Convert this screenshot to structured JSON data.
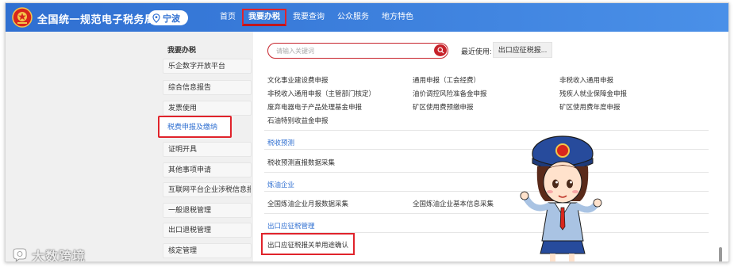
{
  "header": {
    "site_title": "全国统一规范电子税务局",
    "city": "宁波",
    "nav": [
      "首页",
      "我要办税",
      "我要查询",
      "公众服务",
      "地方特色"
    ]
  },
  "sidebar": {
    "heading": "我要办税",
    "items": [
      "乐企数字开放平台",
      "综合信息报告",
      "发票使用",
      "税费申报及缴纳",
      "证明开具",
      "其他事项申请",
      "互联网平台企业涉税信息报送",
      "一般退税管理",
      "出口退税管理",
      "核定管理"
    ]
  },
  "search": {
    "placeholder": "请输入关键词"
  },
  "recent": {
    "label": "最近使用:",
    "item": "出口应征税报..."
  },
  "sections": {
    "declare_links": [
      [
        "文化事业建设费申报",
        "通用申报（工会经费）",
        "非税收入通用申报"
      ],
      [
        "非税收入通用申报（主管部门核定）",
        "油价调控风险准备金申报",
        "残疾人就业保障金申报"
      ],
      [
        "废弃电器电子产品处理基金申报",
        "矿区使用费预缴申报",
        "矿区使用费年度申报"
      ],
      [
        "石油特别收益金申报"
      ]
    ],
    "forecast": {
      "title": "税收预测",
      "links": [
        "税收预测直报数据采集"
      ]
    },
    "refinery": {
      "title": "炼油企业",
      "links": [
        "全国炼油企业月报数据采集",
        "全国炼油企业基本信息采集"
      ]
    },
    "export": {
      "title": "出口应征税管理",
      "links": [
        "出口应征税报关单用途确认"
      ]
    }
  },
  "watermark": {
    "text": "大数跨境"
  },
  "colors": {
    "header_blue": "#2f6fd1",
    "highlight_red": "#e0232b"
  }
}
